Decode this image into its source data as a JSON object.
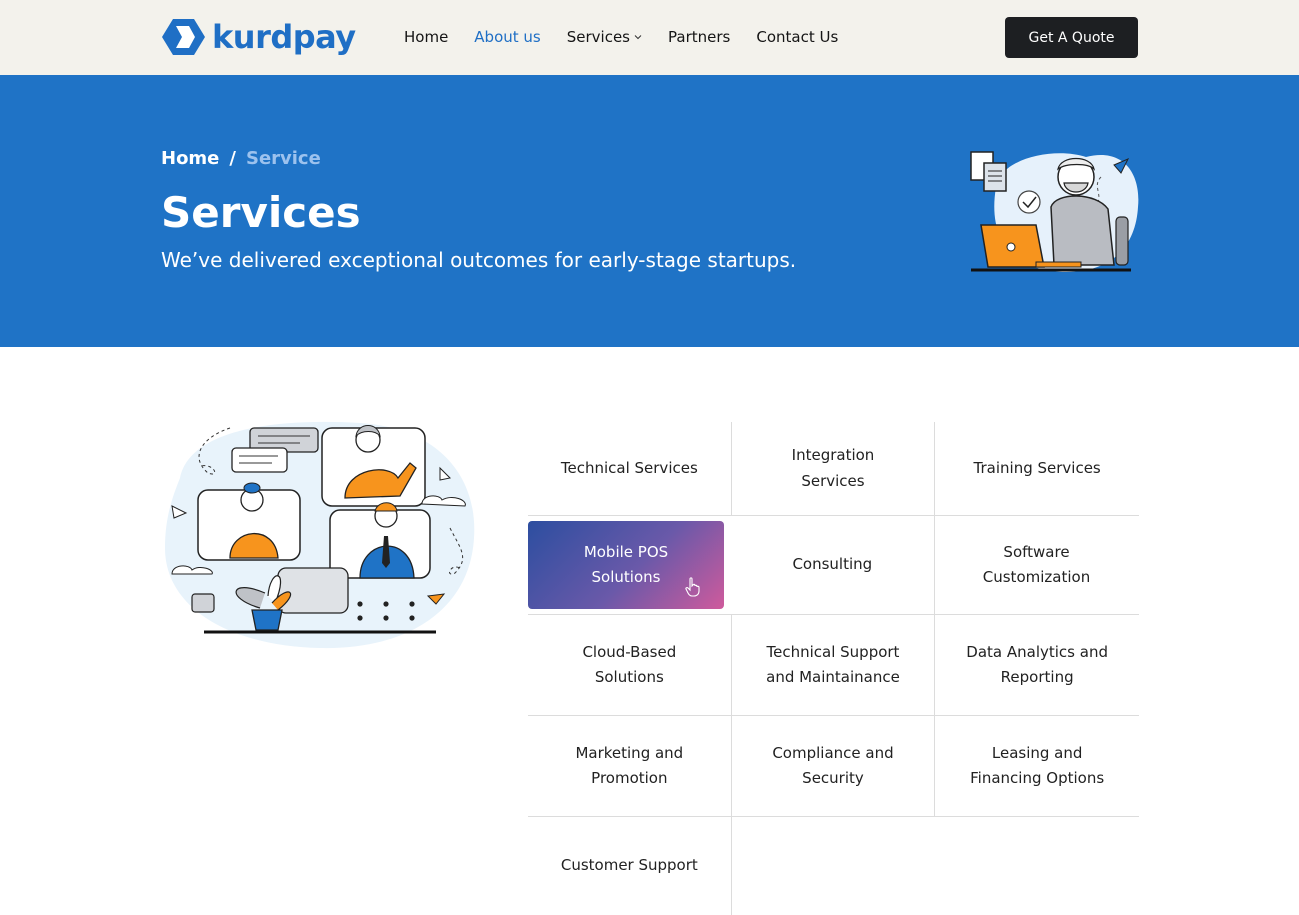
{
  "brand": {
    "name": "kurdpay",
    "color": "#1f6fc5"
  },
  "nav": {
    "items": [
      {
        "label": "Home"
      },
      {
        "label": "About us",
        "active": true
      },
      {
        "label": "Services",
        "has_dropdown": true
      },
      {
        "label": "Partners"
      },
      {
        "label": "Contact Us"
      }
    ],
    "cta": "Get A Quote"
  },
  "hero": {
    "breadcrumb": {
      "home": "Home",
      "separator": "/",
      "current": "Service"
    },
    "title": "Services",
    "subtitle": "We’ve delivered exceptional outcomes for early-stage startups.",
    "bg_color": "#1f73c6"
  },
  "services": {
    "rows": [
      [
        "Technical Services",
        "Integration Services",
        "Training Services"
      ],
      [
        "Mobile POS Solutions",
        "Consulting",
        "Software Customization"
      ],
      [
        "Cloud-Based Solutions",
        "Technical Support and Maintainance",
        "Data Analytics and Reporting"
      ],
      [
        "Marketing and Promotion",
        "Compliance and Security",
        "Leasing and Financing Options"
      ],
      [
        "Customer Support"
      ]
    ],
    "highlighted": "Mobile POS Solutions"
  }
}
